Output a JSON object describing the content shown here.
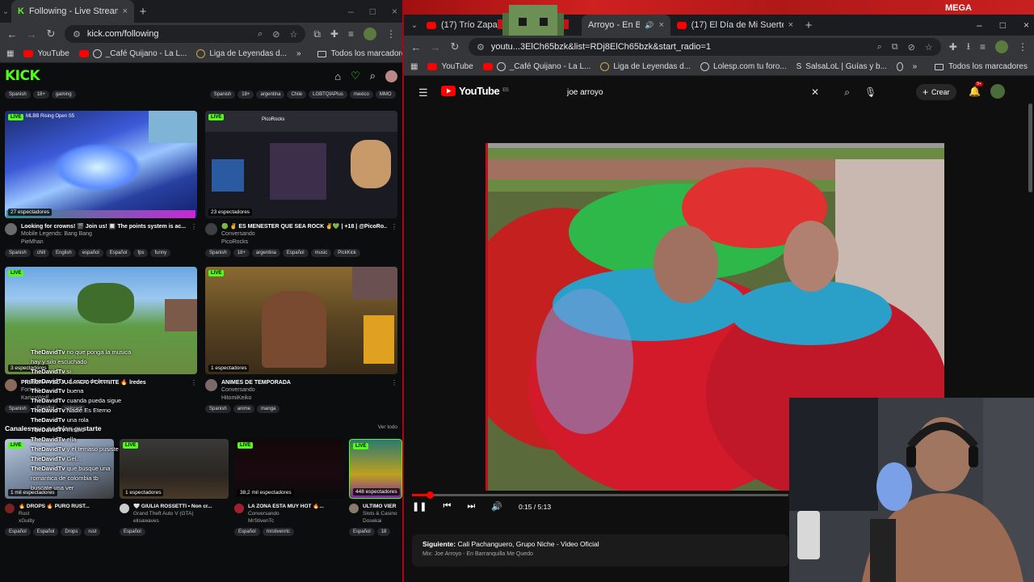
{
  "left_window": {
    "tab": {
      "title": "Following - Live Streams on Kick",
      "close": "×"
    },
    "new_tab": "+",
    "window_controls": [
      "–",
      "□",
      "×"
    ],
    "address": {
      "url": "kick.com/following"
    },
    "nav": {
      "back": "←",
      "forward": "→",
      "reload": "↻"
    },
    "bookmarks": [
      {
        "label": "YouTube",
        "icon": "youtube-icon"
      },
      {
        "label": "_Café Quijano - La L...",
        "icon": "globe-icon"
      },
      {
        "label": "Liga de Leyendas d...",
        "icon": "lol-icon"
      }
    ],
    "bookmarks_overflow": "»",
    "all_bookmarks": "Todos los marcadores",
    "kick": {
      "logo": "KICK",
      "top_chips": [
        "Spanish",
        "18+",
        "gaming"
      ],
      "streams": [
        {
          "title": "Looking for crowns! 🎬 Join us! 🔲 The points system is ac...",
          "sub1": "Mobile Legends: Bang Bang",
          "sub2": "PieMhan",
          "viewers": "27 espectadores",
          "live": "LIVE",
          "tags": [
            "Spanish",
            "chill",
            "English",
            "español",
            "Español",
            "fps",
            "funny"
          ],
          "thumb_text": "MLBB Rising Open S5"
        },
        {
          "title": "🟢 ✌ ES MENESTER QUE SEA ROCK ✌💚 | +18 | @PicoRo...",
          "sub1": "Conversando",
          "sub2": "PicoRocks",
          "viewers": "23 espectadores",
          "live": "LIVE",
          "tags": [
            "Spanish",
            "18+",
            "argentina",
            "Español",
            "music",
            "PickKick"
          ],
          "top_tags": [
            "Spanish",
            "18+",
            "argentina",
            "Chile",
            "LGBTQIAPlus",
            "mexico",
            "MMO"
          ],
          "thumb_text": "PicoRocks"
        },
        {
          "title": "PRIMERA VEZ JUGANDO FORTNITE 🔥 lredes",
          "sub1": "Fortnite",
          "sub2": "KarinaWolf",
          "viewers": "3 espectadores",
          "live": "LIVE",
          "tags": [
            "Spanish",
            "Español",
            "valorant"
          ],
          "thumb_text": ""
        },
        {
          "title": "ANIMES DE TEMPORADA",
          "sub1": "Conversando",
          "sub2": "HitomiKeiko",
          "viewers": "1 espectadores",
          "live": "LIVE",
          "tags": [
            "Spanish",
            "anime",
            "manga"
          ],
          "thumb_text": ""
        }
      ],
      "section_title": "Canales que podrían gustarte",
      "see_all": "Ver todo",
      "recommended": [
        {
          "title": "🔥 DROPS 🔥 PURO RUST...",
          "sub1": "Rust",
          "sub2": "xGuilty",
          "viewers": "1 mil espectadores",
          "live": "LIVE",
          "tags": [
            "Español",
            "Español",
            "Drops",
            "rust"
          ]
        },
        {
          "title": "🤍 GIULIA ROSSETTI • Non cr...",
          "sub1": "Grand Theft Auto V (GTA)",
          "sub2": "elisawaves",
          "viewers": "1 espectadores",
          "live": "LIVE",
          "tags": [
            "Español"
          ]
        },
        {
          "title": "LA ZONA ESTA MUY HOT 🔥...",
          "sub1": "Conversando",
          "sub2": "MrStivenTc",
          "viewers": "38,2 mil espectadores",
          "live": "LIVE",
          "tags": [
            "Español",
            "mrstivenrtc"
          ]
        },
        {
          "title": "ULTIMO VIER",
          "sub1": "Slots & Casino",
          "sub2": "Dosekai",
          "viewers": "448 espectadores",
          "live": "LIVE",
          "tags": [
            "Español",
            "18"
          ]
        }
      ],
      "chat_overlay": [
        {
          "user": "TheDavidTv",
          "msg": "no que ponga la musica hay y silo escuchado"
        },
        {
          "user": "TheDavidTv",
          "msg": "si"
        },
        {
          "user": "TheDavidTv",
          "msg": "uf oscar de leon"
        },
        {
          "user": "TheDavidTv",
          "msg": "buena"
        },
        {
          "user": "TheDavidTv",
          "msg": "cuanda pueda sigue"
        },
        {
          "user": "TheDavidTv",
          "msg": "Nadie Es Eterno"
        },
        {
          "user": "TheDavidTv",
          "msg": "una rola"
        },
        {
          "user": "TheDavidTv",
          "msg": "mismo"
        },
        {
          "user": "TheDavidTv",
          "msg": "ella"
        },
        {
          "user": "TheDavidTv",
          "msg": "y el temaso pusiste"
        },
        {
          "user": "TheDavidTv",
          "msg": "Gel..."
        },
        {
          "user": "TheDavidTv",
          "msg": "que busque una romantica de colombia tb"
        },
        {
          "user": "",
          "msg": "buscate una ver"
        }
      ]
    }
  },
  "right_window": {
    "tabs": [
      {
        "title": "(17) Trío Zapatista...",
        "active": false
      },
      {
        "title": "Arroyo - En Barran...",
        "active": true
      },
      {
        "title": "(17) El Día de Mi Suerte Hector...",
        "active": false
      }
    ],
    "new_tab": "+",
    "window_controls": [
      "–",
      "□",
      "×"
    ],
    "address": {
      "url": "youtu...3ElCh65bzk&list=RDj8ElCh65bzk&start_radio=1"
    },
    "bookmarks": [
      {
        "label": "YouTube",
        "icon": "youtube-icon"
      },
      {
        "label": "_Café Quijano - La L...",
        "icon": "globe-icon"
      },
      {
        "label": "Liga de Leyendas d...",
        "icon": "lol-icon"
      },
      {
        "label": "Lolesp.com tu foro...",
        "icon": "globe-icon"
      },
      {
        "label": "SalsaLoL | Guías y b...",
        "icon": "salsa-icon"
      }
    ],
    "bookmarks_overflow": "»",
    "all_bookmarks": "Todos los marcadores",
    "youtube": {
      "logo": "YouTube",
      "region": "ES",
      "search_value": "joe arroyo",
      "create_label": "Crear",
      "notif_count": "9+",
      "time": "0:15 / 5:13",
      "progress": 0.048,
      "next_prefix": "Siguiente:",
      "next_title": "Cali Pachanguero, Grupo Niche - Video Oficial",
      "mix_label": "Mix: Joe Arroyo - En Barranquilla Me Quedo"
    },
    "top_banner": "MEGA"
  },
  "colors": {
    "kick_green": "#53fc18",
    "youtube_red": "#ff0000",
    "divider": "#b30012"
  }
}
